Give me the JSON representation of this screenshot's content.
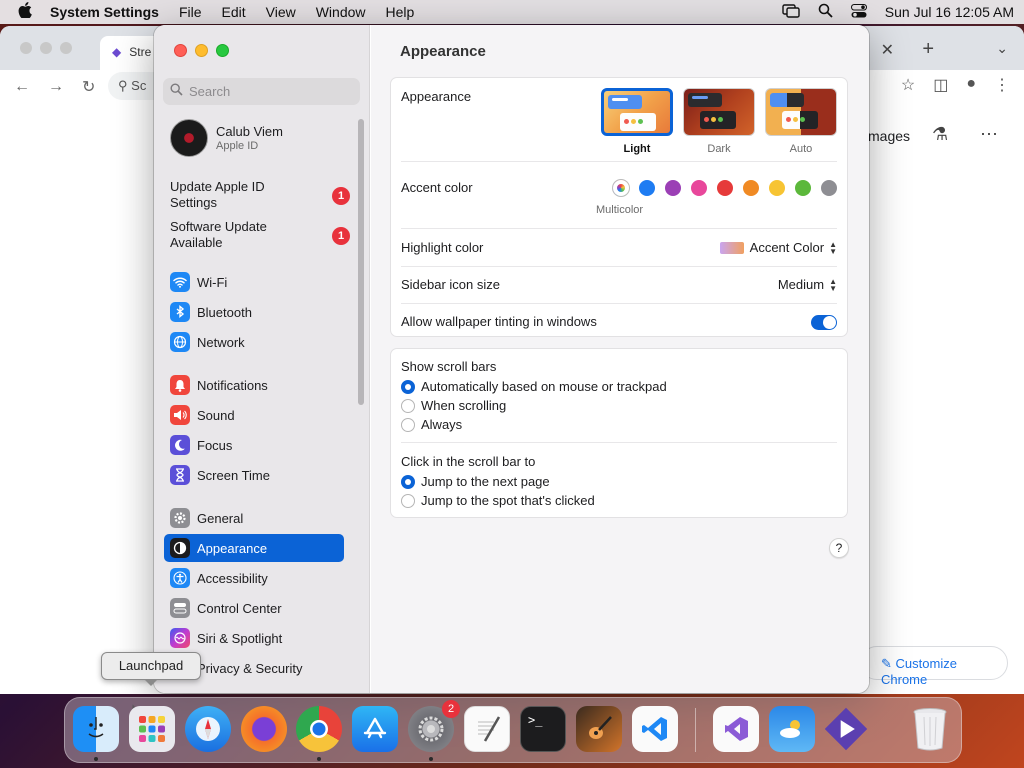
{
  "menubar": {
    "app_name": "System Settings",
    "items": [
      "File",
      "Edit",
      "View",
      "Window",
      "Help"
    ],
    "datetime": "Sun Jul 16  12:05 AM"
  },
  "chrome": {
    "tab_title": "Stre",
    "omnibox_text": "Sc",
    "images_link": "mages",
    "customize_label": "Customize Chrome"
  },
  "sidebar": {
    "search_placeholder": "Search",
    "account": {
      "name": "Calub Viem",
      "subtitle": "Apple ID"
    },
    "notices": [
      {
        "label": "Update Apple ID Settings",
        "badge": "1"
      },
      {
        "label": "Software Update Available",
        "badge": "1"
      }
    ],
    "items": [
      {
        "label": "Wi-Fi",
        "icon": "wifi-icon",
        "color": "#1e88f5"
      },
      {
        "label": "Bluetooth",
        "icon": "bluetooth-icon",
        "color": "#1e88f5"
      },
      {
        "label": "Network",
        "icon": "globe-icon",
        "color": "#1e88f5"
      },
      {
        "label": "Notifications",
        "icon": "bell-icon",
        "color": "#f0463c"
      },
      {
        "label": "Sound",
        "icon": "speaker-icon",
        "color": "#f0463c"
      },
      {
        "label": "Focus",
        "icon": "moon-icon",
        "color": "#5b4fd8"
      },
      {
        "label": "Screen Time",
        "icon": "hourglass-icon",
        "color": "#5b4fd8"
      },
      {
        "label": "General",
        "icon": "gear-icon",
        "color": "#8e8e93"
      },
      {
        "label": "Appearance",
        "icon": "appearance-icon",
        "color": "#1c1c1e"
      },
      {
        "label": "Accessibility",
        "icon": "accessibility-icon",
        "color": "#1e88f5"
      },
      {
        "label": "Control Center",
        "icon": "control-center-icon",
        "color": "#8e8e93"
      },
      {
        "label": "Siri & Spotlight",
        "icon": "siri-icon",
        "color": "#c03bd0"
      },
      {
        "label": "Privacy & Security",
        "icon": "hand-icon",
        "color": "#1e88f5"
      }
    ]
  },
  "main": {
    "title": "Appearance",
    "appearance_label": "Appearance",
    "themes": [
      "Light",
      "Dark",
      "Auto"
    ],
    "selected_theme": "Light",
    "accent_label": "Accent color",
    "accent_colors": [
      "#1e7cf2",
      "#9b3fb5",
      "#e8479b",
      "#e63a3a",
      "#f08a24",
      "#f7c433",
      "#5cb83b",
      "#8e8e93"
    ],
    "multicolor_label": "Multicolor",
    "highlight_label": "Highlight color",
    "highlight_value": "Accent Color",
    "icon_size_label": "Sidebar icon size",
    "icon_size_value": "Medium",
    "tinting_label": "Allow wallpaper tinting in windows",
    "tinting_on": true,
    "scroll_label": "Show scroll bars",
    "scroll_options": [
      "Automatically based on mouse or trackpad",
      "When scrolling",
      "Always"
    ],
    "click_label": "Click in the scroll bar to",
    "click_options": [
      "Jump to the next page",
      "Jump to the spot that's clicked"
    ],
    "help": "?"
  },
  "tooltip": "Launchpad",
  "dock": {
    "apps": [
      "Finder",
      "Launchpad",
      "Safari",
      "Firefox",
      "Chrome",
      "App Store",
      "System Settings",
      "TextEdit",
      "Terminal",
      "GarageBand",
      "VS Code",
      "Visual Studio",
      "Weather",
      "Stremio",
      "Trash"
    ],
    "settings_badge": "2"
  }
}
